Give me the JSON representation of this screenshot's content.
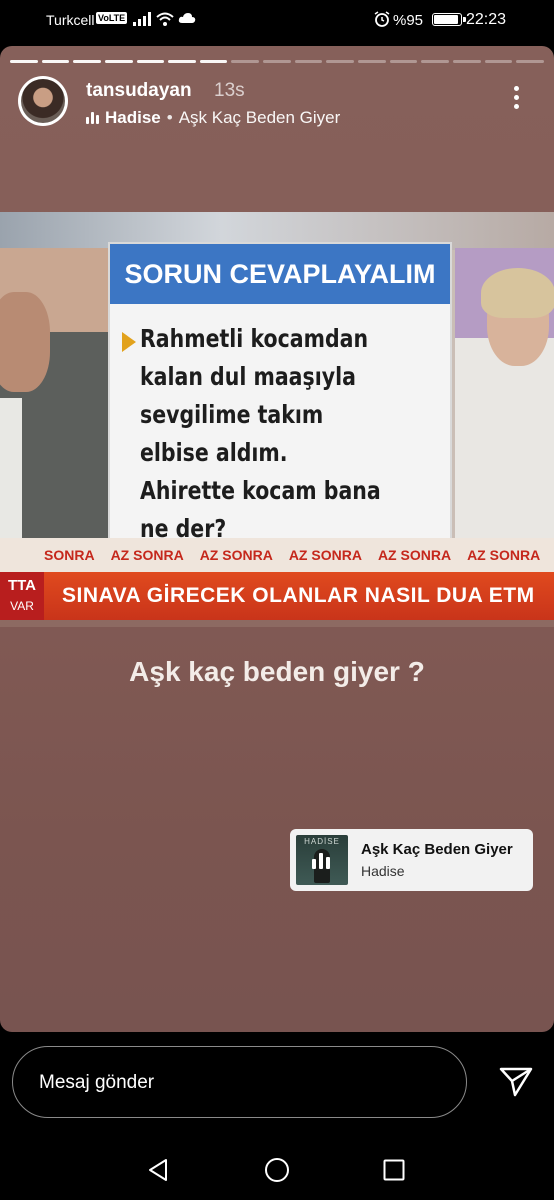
{
  "status_bar": {
    "carrier": "Turkcell",
    "volte": "VoLTE",
    "battery_percent": "%95",
    "battery_level": 0.95,
    "time": "22:23"
  },
  "story": {
    "progress": {
      "total_segments": 17,
      "completed_segments": 7
    },
    "username": "tansudayan",
    "time_ago": "13s",
    "music_artist": "Hadise",
    "music_separator": "•",
    "music_song": "Aşk Kaç Beden Giyer",
    "caption": "Aşk kaç beden giyer ?",
    "tv_screenshot": {
      "card_title": "SORUN CEVAPLAYALIM",
      "card_text": "Rahmetli kocamdan kalan dul maaşıyla sevgilime takım elbise aldım. Ahirette kocam bana ne der?",
      "ticker": [
        "SONRA",
        "AZ SONRA",
        "AZ SONRA",
        "AZ SONRA",
        "AZ SONRA",
        "AZ SONRA"
      ],
      "tag_top": "TTA",
      "tag_bottom": "VAR",
      "red_bar_text": "SINAVA GİRECEK OLANLAR NASIL DUA ETM"
    },
    "music_sticker": {
      "cover_label": "HADİSE",
      "title": "Aşk Kaç Beden Giyer",
      "artist": "Hadise"
    }
  },
  "reply": {
    "placeholder": "Mesaj gönder"
  },
  "icons": {
    "more": "more-vertical-icon",
    "send": "send-icon",
    "back": "back-triangle-icon",
    "home": "home-circle-icon",
    "recent": "recent-square-icon"
  }
}
